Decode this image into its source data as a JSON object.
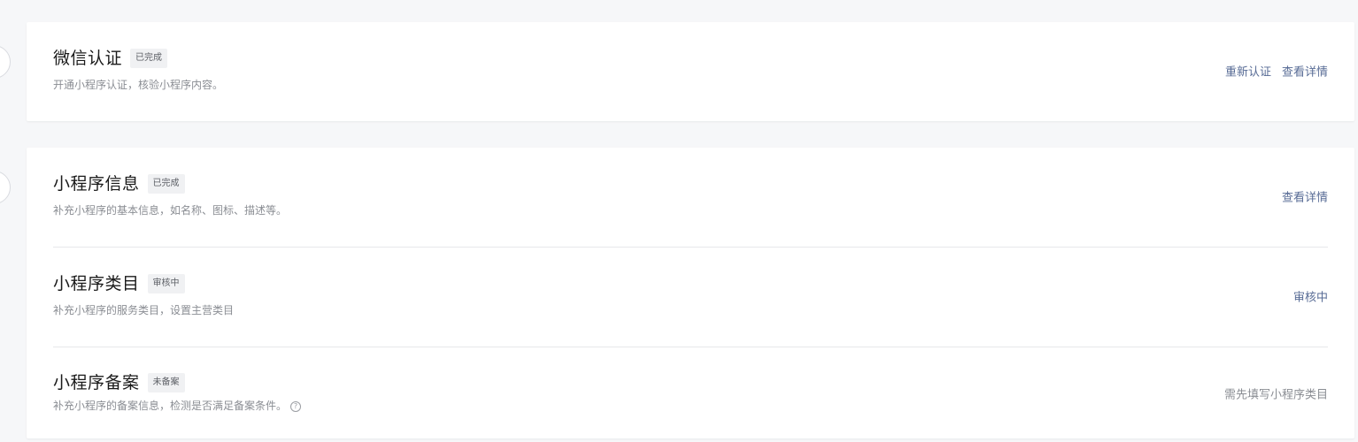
{
  "sections": [
    {
      "title": "微信认证",
      "badge": "已完成",
      "desc": "开通小程序认证，核验小程序内容。",
      "actions": [
        "重新认证",
        "查看详情"
      ]
    },
    {
      "title": "小程序信息",
      "badge": "已完成",
      "desc": "补充小程序的基本信息，如名称、图标、描述等。",
      "actions": [
        "查看详情"
      ]
    },
    {
      "title": "小程序类目",
      "badge": "审核中",
      "desc": "补充小程序的服务类目，设置主营类目",
      "actions": [
        "审核中"
      ]
    },
    {
      "title": "小程序备案",
      "badge": "未备案",
      "desc": "补充小程序的备案信息，检测是否满足备案条件。",
      "help_icon": "?",
      "actions": [
        "需先填写小程序类目"
      ]
    }
  ],
  "colors": {
    "link": "#576b95",
    "muted": "#8a8d93"
  }
}
